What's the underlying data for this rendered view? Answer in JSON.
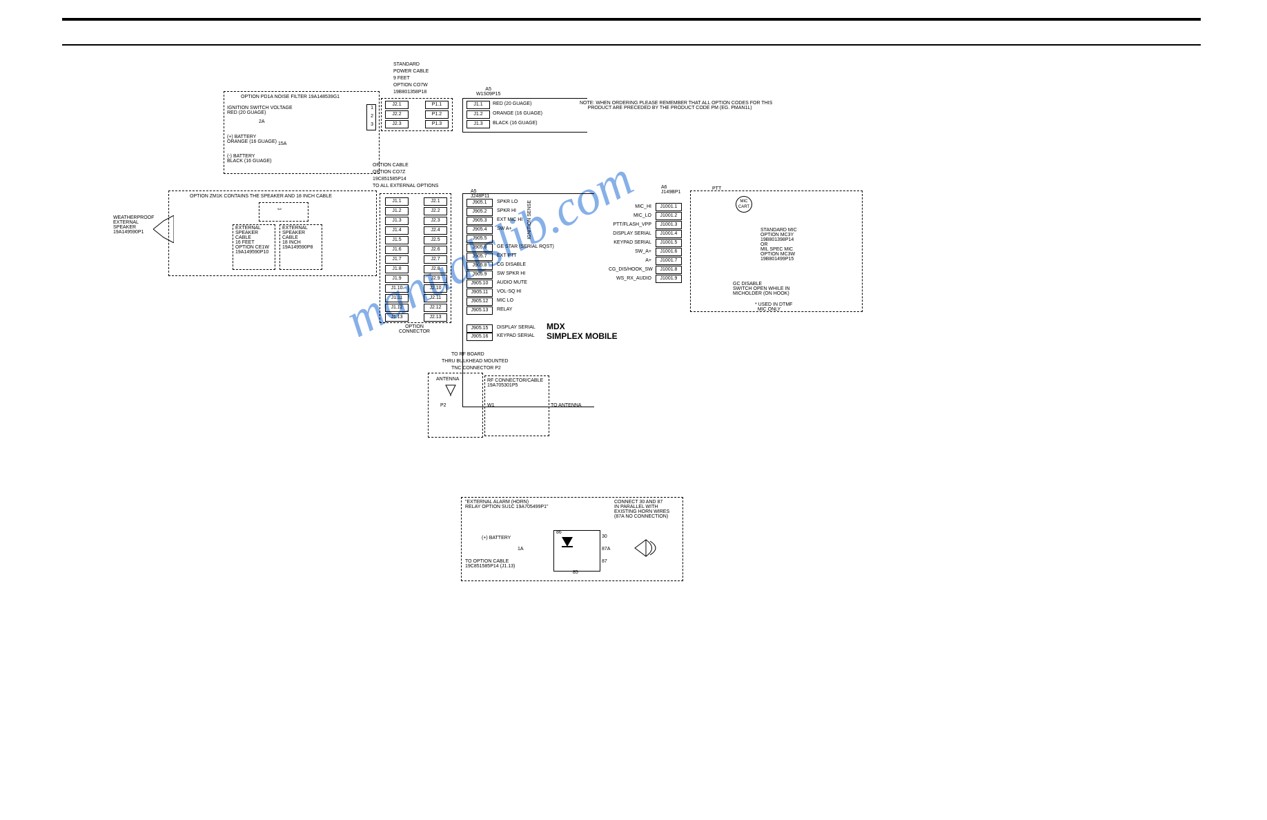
{
  "top_header": {
    "std_cable_1": "STANDARD",
    "std_cable_2": "POWER CABLE",
    "std_cable_3": "9 FEET",
    "std_cable_4": "OPTION CO7W",
    "std_cable_5": "19B801358P18",
    "as_label": "A5\nW1S09P15"
  },
  "note": "NOTE: WHEN ORDERING PLEASE REMEMBER THAT ALL OPTION CODES FOR THIS\n      PRODUCT ARE PRECEDED BY THE PRODUCT CODE PM (EG. PMAN1L)",
  "filter_box": {
    "title": "OPTION PD1A NOISE FILTER 19A148539G1",
    "ignition": "IGNITION SWITCH VOLTAGE\nRED (20 GUAGE)",
    "amp20": "2A",
    "batt_pos": "(+) BATTERY\nORANGE (16 GUAGE)",
    "amp15": "15A",
    "batt_neg": "(-) BATTERY\nBLACK (16 GUAGE)"
  },
  "power_pins_left": [
    "J2.1",
    "J2.2",
    "J2.3"
  ],
  "power_pins_right": [
    "P1.1",
    "P1.2",
    "P1.3"
  ],
  "a5_j1": [
    "J1.1",
    "J1.2",
    "J1.3"
  ],
  "a5_j1_labels": [
    "RED (20 GUAGE)",
    "ORANGE (16 GUAGE)",
    "BLACK (16 GUAGE)"
  ],
  "option_cable": {
    "l1": "OPTION CABLE",
    "l2": "OPTION CO7Z",
    "l3": "19C851585P14",
    "l4": "TO ALL EXTERNAL OPTIONS"
  },
  "speaker_box": {
    "title": "OPTION ZM1K CONTAINS THE SPEAKER AND 18 INCH CABLE",
    "wx": "WEATHERPROOF\nEXTERNAL\nSPEAKER\n19A149590P1",
    "cable16": "EXTERNAL\nSPEAKER\nCABLE\n16 FEET\nOPTION CE1W\n19A149590P10",
    "cable18": "EXTERNAL\nSPEAKER\nCABLE\n18 INCH\n19A149590P8"
  },
  "opt_conn_left": [
    "J1.1",
    "J1.2",
    "J1.3",
    "J1.4",
    "J1.5",
    "J1.6",
    "J1.7",
    "J1.8",
    "J1.9",
    "J1.10",
    "J1.11",
    "J1.12",
    "J1.13"
  ],
  "opt_conn_right": [
    "J2.1",
    "J2.2",
    "J2.3",
    "J2.4",
    "J2.5",
    "J2.6",
    "J2.7",
    "J2.8",
    "J2.9",
    "J2.10",
    "J2.11",
    "J2.12",
    "J2.13"
  ],
  "opt_conn_label": "OPTION\nCONNECTOR",
  "j905_header": "A5\nJ248P11",
  "j905_pins": [
    "J905.1",
    "J905.2",
    "J905.3",
    "J905.4",
    "J905.5",
    "J905.6",
    "J905.7",
    "J905.8",
    "J905.9",
    "J905.10",
    "J905.11",
    "J905.12",
    "J905.13"
  ],
  "j905_extra": [
    "J905.15",
    "J905.16"
  ],
  "j905_labels": [
    "",
    "SPKR LO",
    "SPKR HI",
    "EXT MIC HI",
    "SW A+",
    "",
    "GE STAR (SERIAL RQST)",
    "EXT PTT",
    "CG DISABLE",
    "SW SPKR HI",
    "AUDIO MUTE",
    "VOL-SQ HI",
    "MIC LO",
    "RELAY"
  ],
  "j905_extra_labels": [
    "DISPLAY SERIAL",
    "KEYPAD SERIAL"
  ],
  "ignition_sense": "IGNITION SENSE",
  "title_main": "MDX\nSIMPLEX MOBILE",
  "rf_block": {
    "l1": "TO RF BOARD",
    "l2": "THRU BULKHEAD MOUNTED",
    "l3": "TNC CONNECTOR P2",
    "antenna": "ANTENNA",
    "rf_cable": "RF CONNECTOR/CABLE\n19A705301P5",
    "p2": "P2",
    "w1": "W1",
    "to_ant": "TO ANTENNA"
  },
  "mic_block": {
    "a6": "A6\nJ149BP1",
    "ptt": "PTT",
    "mic_cart": "MIC\nCART",
    "signals": [
      "MIC_HI",
      "MIC_LO",
      "PTT/FLASH_VPP",
      "DISPLAY SERIAL",
      "KEYPAD SERIAL",
      "SW_A+",
      "A+",
      "CG_DIS/HOOK_SW",
      "WS_RX_AUDIO"
    ],
    "j1001": [
      "J1001.1",
      "J1001.2",
      "J1001.3",
      "J1001.4",
      "J1001.5",
      "J1001.6",
      "J1001.7",
      "J1001.8",
      "J1001.9"
    ],
    "std_mic": "STANDARD MIC\nOPTION MC3Y\n19B801398P14\nOR\nMIL SPEC MIC\nOPTION MC3W\n19B801499P15",
    "gc_dis": "GC DISABLE\nSWITCH OPEN WHILE IN\nMICHOLDER (ON HOOK)",
    "dtmf": "* USED IN DTMF\n  MIC ONLY"
  },
  "alarm_block": {
    "title": "\"EXTERNAL ALARM (HORN)\nRELAY OPTION SU1C 19A705499P1\"",
    "conn": "CONNECT 30 AND 87\nIN PARALLEL WITH\nEXISTING HORN WIRES\n(87A NO CONNECTION)",
    "batt": "(+) BATTERY",
    "amp": "1A",
    "to_opt": "TO OPTION CABLE\n19C851585P14 (J1.13)",
    "t86": "86",
    "t30": "30",
    "t87a": "87A",
    "t87": "87",
    "t85": "85"
  }
}
